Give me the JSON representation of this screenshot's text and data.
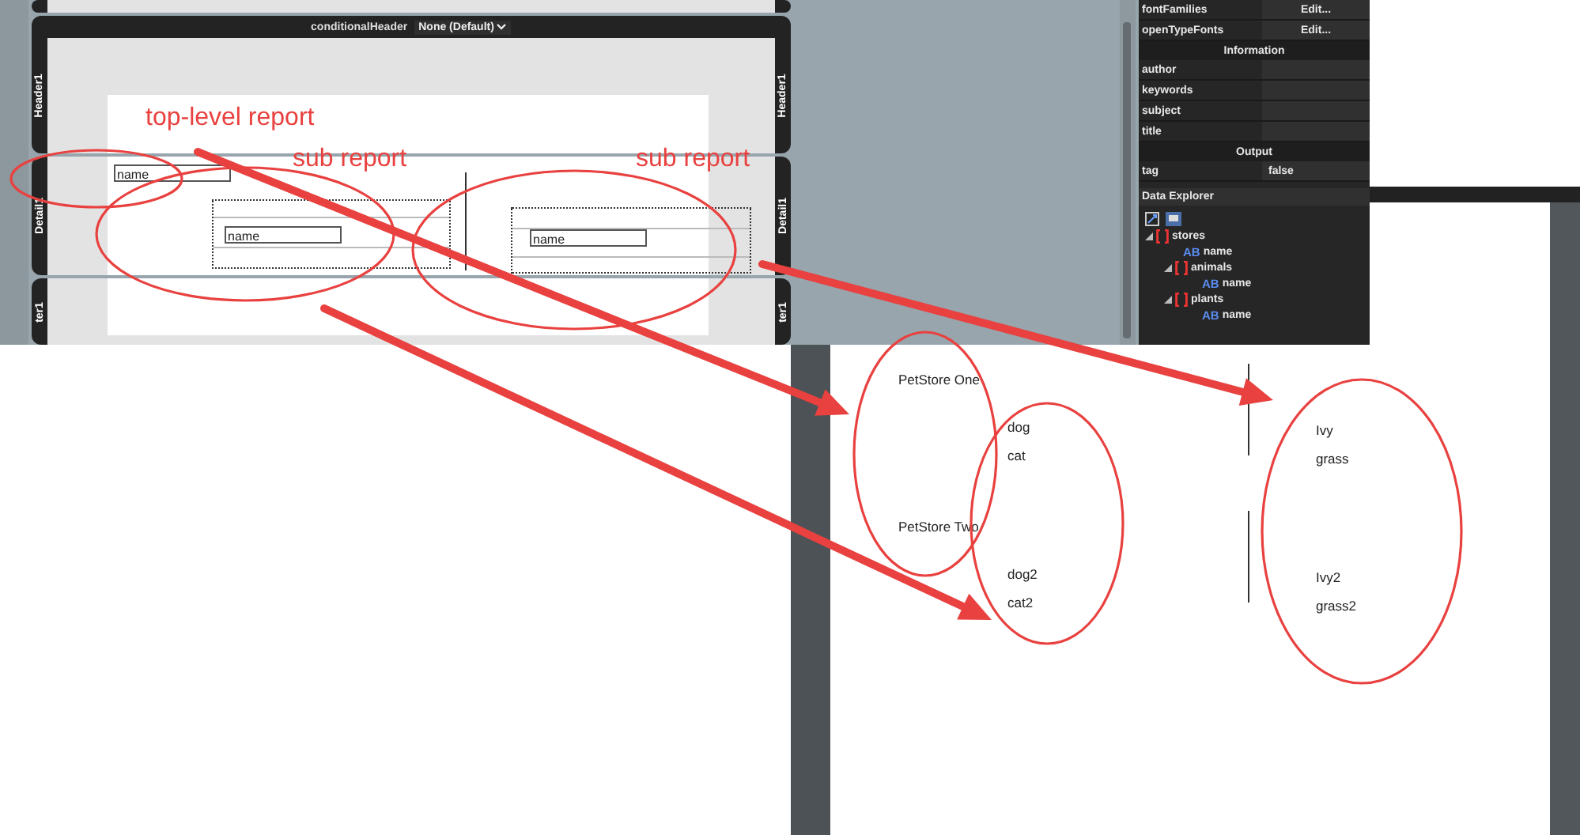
{
  "designer": {
    "conditional_label": "conditionalHeader",
    "conditional_value": "None (Default)",
    "header_labels": [
      "Header1",
      "Header1"
    ],
    "detail_labels": [
      "Detail1",
      "Detail1"
    ],
    "footer_labels": [
      "ter1",
      "ter1"
    ],
    "name_fields": [
      "name",
      "name",
      "name"
    ]
  },
  "properties": {
    "rows": [
      {
        "kind": "button",
        "label": "fontFamilies",
        "value": "Edit..."
      },
      {
        "kind": "button",
        "label": "openTypeFonts",
        "value": "Edit..."
      },
      {
        "kind": "section",
        "label": "Information"
      },
      {
        "kind": "field",
        "label": "author"
      },
      {
        "kind": "field",
        "label": "keywords"
      },
      {
        "kind": "field",
        "label": "subject"
      },
      {
        "kind": "field",
        "label": "title"
      },
      {
        "kind": "section",
        "label": "Output"
      },
      {
        "kind": "select",
        "label": "tag",
        "value": "false"
      }
    ]
  },
  "data_explorer": {
    "title": "Data Explorer",
    "tree": [
      {
        "kind": "array",
        "label": "stores",
        "expanded": true,
        "children": [
          {
            "kind": "text",
            "badge": "AB",
            "label": "name"
          },
          {
            "kind": "array",
            "label": "animals",
            "expanded": true,
            "children": [
              {
                "kind": "text",
                "badge": "AB",
                "label": "name"
              }
            ]
          },
          {
            "kind": "array",
            "label": "plants",
            "expanded": true,
            "children": [
              {
                "kind": "text",
                "badge": "AB",
                "label": "name"
              }
            ]
          }
        ]
      }
    ]
  },
  "preview": {
    "stores": [
      {
        "name": "PetStore One",
        "animals": [
          "dog",
          "cat"
        ],
        "plants": [
          "Ivy",
          "grass"
        ]
      },
      {
        "name": "PetStore Two",
        "animals": [
          "dog2",
          "cat2"
        ],
        "plants": [
          "Ivy2",
          "grass2"
        ]
      }
    ]
  },
  "annotations": {
    "labels": [
      "top-level report",
      "sub report",
      "sub report"
    ]
  }
}
